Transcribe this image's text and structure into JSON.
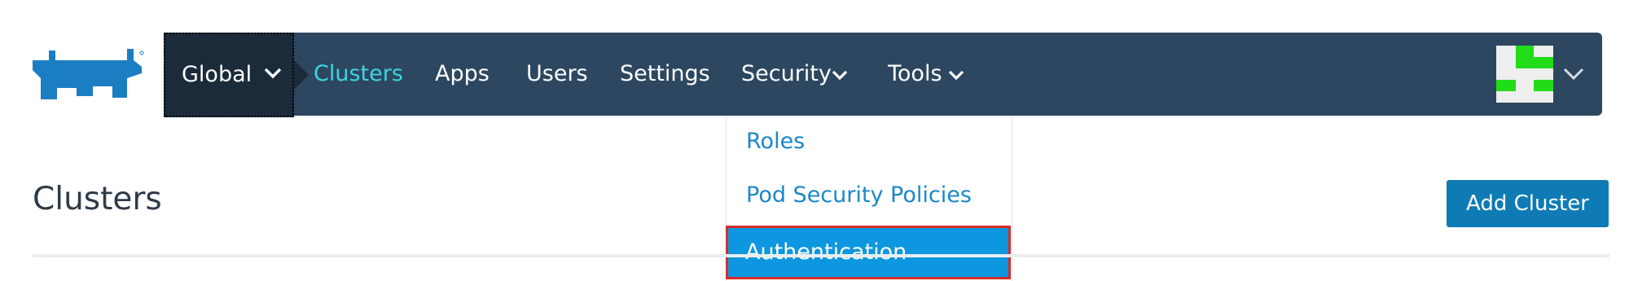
{
  "nav": {
    "global_label": "Global",
    "items": [
      {
        "label": "Clusters",
        "active": true
      },
      {
        "label": "Apps"
      },
      {
        "label": "Users"
      },
      {
        "label": "Settings"
      },
      {
        "label": "Security",
        "has_dropdown": true
      },
      {
        "label": "Tools",
        "has_dropdown": true
      }
    ]
  },
  "security_menu": {
    "items": [
      {
        "label": "Roles"
      },
      {
        "label": "Pod Security Policies"
      },
      {
        "label": "Authentication",
        "highlighted": true
      }
    ]
  },
  "page": {
    "title": "Clusters",
    "add_button_label": "Add Cluster"
  },
  "colors": {
    "navbar_bg": "#2d4760",
    "global_bg": "#1b2b3a",
    "active_nav": "#3ed4e0",
    "dropdown_link": "#1a87c9",
    "highlight_bg": "#0d97e0",
    "highlight_border": "#d52d27",
    "primary_button": "#0f7bb5",
    "logo": "#1b7ec2",
    "avatar_accent": "#22dc18"
  },
  "icons": {
    "logo": "rancher-cow-logo",
    "dropdown": "chevron-down-icon",
    "avatar": "identicon-avatar"
  }
}
